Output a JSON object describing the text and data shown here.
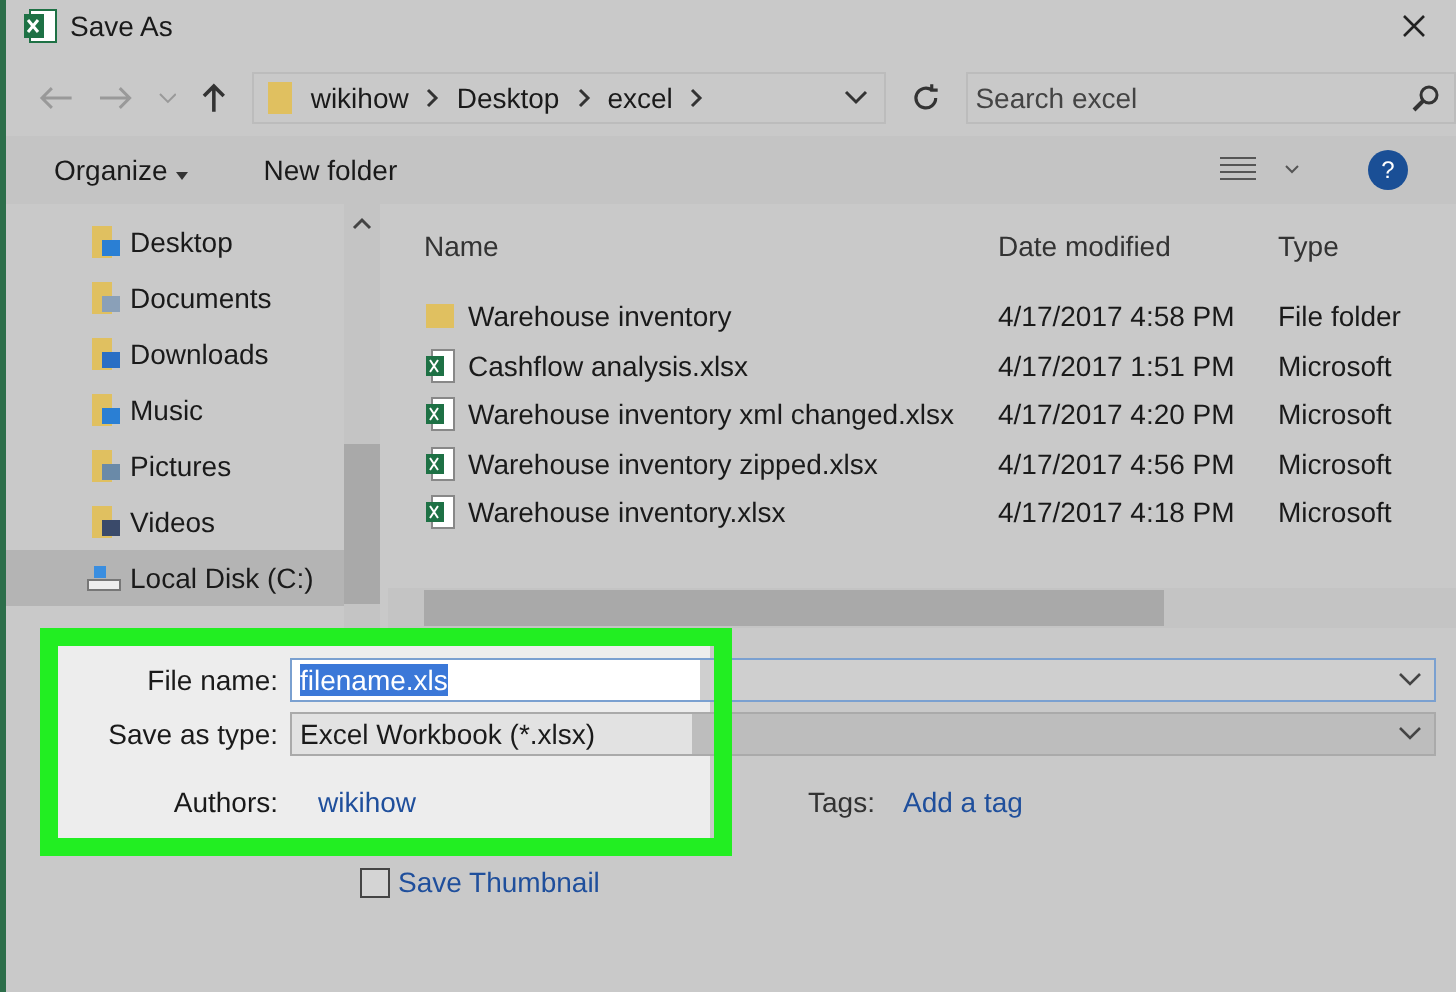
{
  "window": {
    "title": "Save As"
  },
  "nav": {
    "breadcrumbs": [
      "wikihow",
      "Desktop",
      "excel"
    ],
    "search": {
      "placeholder": "Search excel"
    }
  },
  "toolbar": {
    "organize": "Organize",
    "new_folder": "New folder",
    "help": "?"
  },
  "sidebar": {
    "items": [
      {
        "label": "Desktop",
        "kind": "desktop",
        "selected": false
      },
      {
        "label": "Documents",
        "kind": "documents",
        "selected": false
      },
      {
        "label": "Downloads",
        "kind": "downloads",
        "selected": false
      },
      {
        "label": "Music",
        "kind": "music",
        "selected": false
      },
      {
        "label": "Pictures",
        "kind": "pictures",
        "selected": false
      },
      {
        "label": "Videos",
        "kind": "videos",
        "selected": false
      },
      {
        "label": "Local Disk (C:)",
        "kind": "drive",
        "selected": true
      }
    ]
  },
  "table": {
    "columns": [
      "Name",
      "Date modified",
      "Type"
    ],
    "rows": [
      {
        "kind": "folder",
        "name": "Warehouse inventory",
        "date": "4/17/2017 4:58 PM",
        "type": "File folder"
      },
      {
        "kind": "excel",
        "name": "Cashflow analysis.xlsx",
        "date": "4/17/2017 1:51 PM",
        "type": "Microsoft"
      },
      {
        "kind": "excel",
        "name": "Warehouse inventory xml changed.xlsx",
        "date": "4/17/2017 4:20 PM",
        "type": "Microsoft"
      },
      {
        "kind": "excel",
        "name": "Warehouse inventory zipped.xlsx",
        "date": "4/17/2017 4:56 PM",
        "type": "Microsoft"
      },
      {
        "kind": "excel",
        "name": "Warehouse inventory.xlsx",
        "date": "4/17/2017 4:18 PM",
        "type": "Microsoft"
      }
    ]
  },
  "form": {
    "file_name_label": "File name:",
    "file_name": "filename.xls",
    "type_label": "Save as type:",
    "type": "Excel Workbook (*.xlsx)",
    "authors_label": "Authors:",
    "authors": "wikihow",
    "tags_label": "Tags:",
    "tags": "Add a tag",
    "thumbnail_label": "Save Thumbnail",
    "thumbnail_checked": false
  }
}
